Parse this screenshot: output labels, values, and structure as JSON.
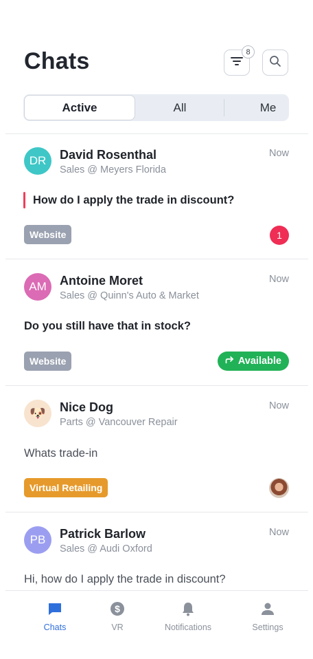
{
  "header": {
    "title": "Chats",
    "filter_count": "8"
  },
  "segments": {
    "active": "Active",
    "all": "All",
    "me": "Me"
  },
  "chats": [
    {
      "initials": "DR",
      "avatar_color": "#3ec7c6",
      "name": "David Rosenthal",
      "subtitle": "Sales @ Meyers Florida",
      "time": "Now",
      "message": "How do I apply the trade in discount?",
      "tag": "Website",
      "unread": "1"
    },
    {
      "initials": "AM",
      "avatar_color": "#db6bb4",
      "name": "Antoine Moret",
      "subtitle": "Sales @ Quinn's Auto & Market",
      "time": "Now",
      "message": "Do you still have that in stock?",
      "tag": "Website",
      "status": "Available"
    },
    {
      "avatar_emoji": "🐶",
      "avatar_color": "#f8e3cf",
      "name": "Nice Dog",
      "subtitle": "Parts @ Vancouver Repair",
      "time": "Now",
      "message": "Whats trade-in",
      "tag": "Virtual Retailing"
    },
    {
      "initials": "PB",
      "avatar_color": "#9b9ef0",
      "name": "Patrick Barlow",
      "subtitle": "Sales @ Audi Oxford",
      "time": "Now",
      "message": "Hi, how do I apply the trade in discount?"
    }
  ],
  "tabs": {
    "chats": "Chats",
    "vr": "VR",
    "notifications": "Notifications",
    "settings": "Settings"
  },
  "colors": {
    "accent": "#2f6fdc",
    "unread_badge": "#ef2d55",
    "available": "#21b257",
    "tag_gray": "#9aa1b0",
    "tag_orange": "#e69a2b"
  }
}
